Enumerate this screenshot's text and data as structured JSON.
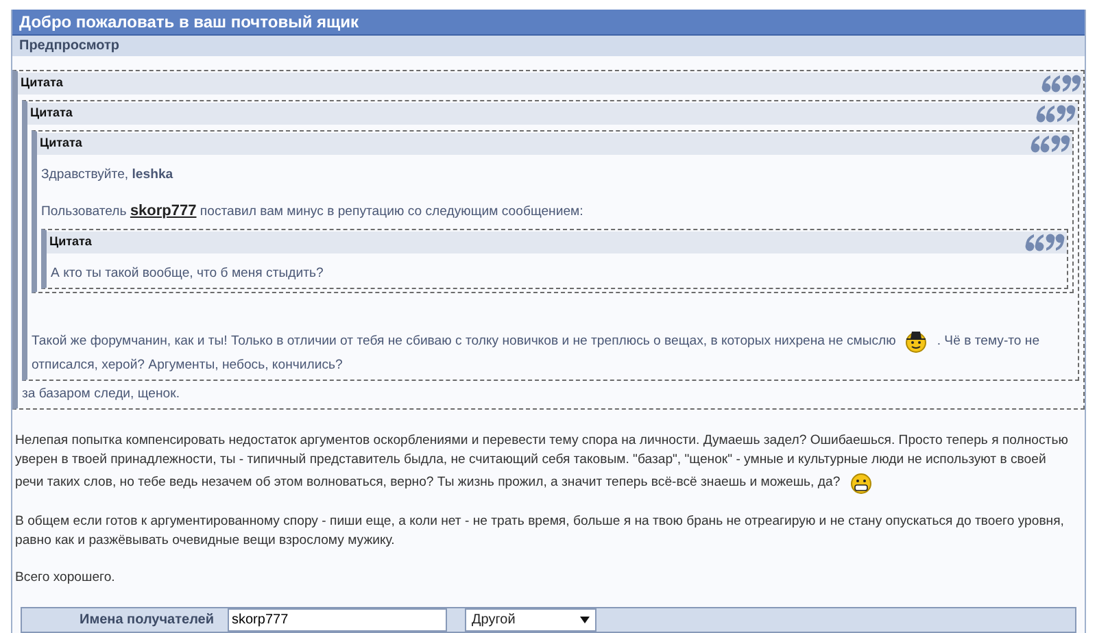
{
  "window": {
    "title": "Добро пожаловать в ваш почтовый ящик"
  },
  "section": {
    "title": "Предпросмотр"
  },
  "quote": {
    "label": "Цитата",
    "blocks": [
      {
        "kind": "quote",
        "label": "Цитата",
        "blocks": [
          {
            "kind": "quote",
            "label": "Цитата",
            "blocks": [
              {
                "kind": "para",
                "parts": [
                  {
                    "kind": "text",
                    "text": "Здравствуйте, **leshka**"
                  }
                ]
              },
              {
                "kind": "para",
                "parts": [
                  {
                    "kind": "text",
                    "text": "Пользователь"
                  },
                  {
                    "kind": "link",
                    "text": "skorp777"
                  },
                  {
                    "kind": "text",
                    "text": "поставил вам минус в репутацию со следующим сообщением:"
                  }
                ]
              },
              {
                "kind": "quote",
                "label": "Цитата",
                "blocks": [
                  {
                    "kind": "para",
                    "parts": [
                      {
                        "kind": "text",
                        "text": "А кто ты такой вообще, что б меня стыдить?"
                      }
                    ]
                  }
                ]
              }
            ]
          },
          {
            "kind": "para",
            "parts": [
              {
                "kind": "line",
                "text": "Такой же форумчанин, как и ты! Только в отличии от тебя не сбиваю с толку новичков и не треплюсь о вещах, в которых нихрена не смыслю"
              },
              {
                "kind": "smiley_hat"
              },
              {
                "kind": "line",
                "text": ". Чё в тему-то не"
              },
              {
                "kind": "text",
                "text": "отписался, херой? Аргументы, небось, кончились?"
              }
            ]
          }
        ]
      },
      {
        "kind": "para",
        "parts": [
          {
            "kind": "text",
            "text": "за базаром следи, щенок."
          }
        ]
      }
    ]
  },
  "message": [
    {
      "parts": [
        {
          "kind": "text",
          "text": "Нелепая попытка компенсировать недостаток аргументов оскорблениями и перевести тему спора на личности. Думаешь задел? Ошибаешься. Просто теперь я полностью уверен в твоей принадлежности, ты - типичный представитель быдла, не считающий себя таковым. \"базар\", \"щенок\" - умные и культурные люди не используют в своей"
        },
        {
          "kind": "line",
          "text": "речи таких слов, но тебе ведь незачем об этом волноваться, верно? Ты жизнь прожил, а значит теперь всё-всё знаешь и можешь, да?"
        },
        {
          "kind": "smiley_grin"
        }
      ]
    },
    {
      "parts": [
        {
          "kind": "text",
          "text": "В общем если готов к аргументированному спору - пиши еще, а коли нет - не трать время, больше я на твою брань не отреагирую и не стану опускаться до твоего уровня, равно как и разжёвывать очевидные вещи взрослому мужику."
        }
      ]
    },
    {
      "parts": [
        {
          "kind": "text",
          "text": "Всего хорошего."
        }
      ]
    }
  ],
  "recipients": {
    "label": "Имена получателей",
    "value": "skorp777",
    "select": "Другой"
  }
}
